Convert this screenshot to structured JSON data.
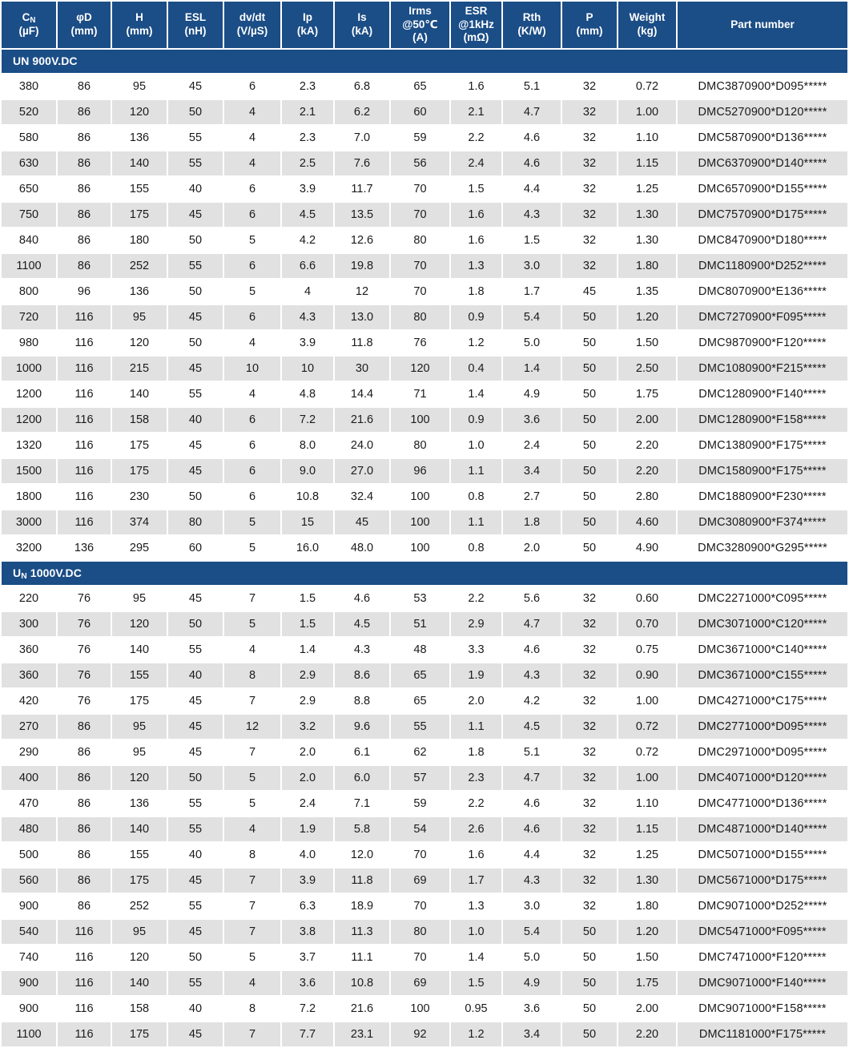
{
  "table": {
    "columns": [
      {
        "key": "cn",
        "name": "Cₙ",
        "sub": "N",
        "base": "C",
        "unit": "(µF)"
      },
      {
        "key": "phid",
        "name": "φD",
        "unit": "(mm)"
      },
      {
        "key": "h",
        "name": "H",
        "unit": "(mm)"
      },
      {
        "key": "esl",
        "name": "ESL",
        "unit": "(nH)"
      },
      {
        "key": "dvdt",
        "name": "dv/dt",
        "unit": "(V/µS)"
      },
      {
        "key": "ip",
        "name": "Ip",
        "unit": "(kA)"
      },
      {
        "key": "is",
        "name": "Is",
        "unit": "(kA)"
      },
      {
        "key": "irms",
        "name": "Irms",
        "unit2": "@50℃",
        "unit": "(A)"
      },
      {
        "key": "esr",
        "name": "ESR",
        "unit2": "@1kHz",
        "unit": "(mΩ)"
      },
      {
        "key": "rth",
        "name": "Rth",
        "unit": "(K/W)"
      },
      {
        "key": "p",
        "name": "P",
        "unit": "(mm)"
      },
      {
        "key": "weight",
        "name": "Weight",
        "unit": "(kg)"
      },
      {
        "key": "part",
        "name": "Part number",
        "unit": ""
      }
    ],
    "sections": [
      {
        "title_base": "UN",
        "title_sub": "",
        "title_rest": " 900V.DC",
        "title_full": "UN 900V.DC",
        "rows": [
          [
            "380",
            "86",
            "95",
            "45",
            "6",
            "2.3",
            "6.8",
            "65",
            "1.6",
            "5.1",
            "32",
            "0.72",
            "DMC3870900*D095*****"
          ],
          [
            "520",
            "86",
            "120",
            "50",
            "4",
            "2.1",
            "6.2",
            "60",
            "2.1",
            "4.7",
            "32",
            "1.00",
            "DMC5270900*D120*****"
          ],
          [
            "580",
            "86",
            "136",
            "55",
            "4",
            "2.3",
            "7.0",
            "59",
            "2.2",
            "4.6",
            "32",
            "1.10",
            "DMC5870900*D136*****"
          ],
          [
            "630",
            "86",
            "140",
            "55",
            "4",
            "2.5",
            "7.6",
            "56",
            "2.4",
            "4.6",
            "32",
            "1.15",
            "DMC6370900*D140*****"
          ],
          [
            "650",
            "86",
            "155",
            "40",
            "6",
            "3.9",
            "11.7",
            "70",
            "1.5",
            "4.4",
            "32",
            "1.25",
            "DMC6570900*D155*****"
          ],
          [
            "750",
            "86",
            "175",
            "45",
            "6",
            "4.5",
            "13.5",
            "70",
            "1.6",
            "4.3",
            "32",
            "1.30",
            "DMC7570900*D175*****"
          ],
          [
            "840",
            "86",
            "180",
            "50",
            "5",
            "4.2",
            "12.6",
            "80",
            "1.6",
            "1.5",
            "32",
            "1.30",
            "DMC8470900*D180*****"
          ],
          [
            "1100",
            "86",
            "252",
            "55",
            "6",
            "6.6",
            "19.8",
            "70",
            "1.3",
            "3.0",
            "32",
            "1.80",
            "DMC1180900*D252*****"
          ],
          [
            "800",
            "96",
            "136",
            "50",
            "5",
            "4",
            "12",
            "70",
            "1.8",
            "1.7",
            "45",
            "1.35",
            "DMC8070900*E136*****"
          ],
          [
            "720",
            "116",
            "95",
            "45",
            "6",
            "4.3",
            "13.0",
            "80",
            "0.9",
            "5.4",
            "50",
            "1.20",
            "DMC7270900*F095*****"
          ],
          [
            "980",
            "116",
            "120",
            "50",
            "4",
            "3.9",
            "11.8",
            "76",
            "1.2",
            "5.0",
            "50",
            "1.50",
            "DMC9870900*F120*****"
          ],
          [
            "1000",
            "116",
            "215",
            "45",
            "10",
            "10",
            "30",
            "120",
            "0.4",
            "1.4",
            "50",
            "2.50",
            "DMC1080900*F215*****"
          ],
          [
            "1200",
            "116",
            "140",
            "55",
            "4",
            "4.8",
            "14.4",
            "71",
            "1.4",
            "4.9",
            "50",
            "1.75",
            "DMC1280900*F140*****"
          ],
          [
            "1200",
            "116",
            "158",
            "40",
            "6",
            "7.2",
            "21.6",
            "100",
            "0.9",
            "3.6",
            "50",
            "2.00",
            "DMC1280900*F158*****"
          ],
          [
            "1320",
            "116",
            "175",
            "45",
            "6",
            "8.0",
            "24.0",
            "80",
            "1.0",
            "2.4",
            "50",
            "2.20",
            "DMC1380900*F175*****"
          ],
          [
            "1500",
            "116",
            "175",
            "45",
            "6",
            "9.0",
            "27.0",
            "96",
            "1.1",
            "3.4",
            "50",
            "2.20",
            "DMC1580900*F175*****"
          ],
          [
            "1800",
            "116",
            "230",
            "50",
            "6",
            "10.8",
            "32.4",
            "100",
            "0.8",
            "2.7",
            "50",
            "2.80",
            "DMC1880900*F230*****"
          ],
          [
            "3000",
            "116",
            "374",
            "80",
            "5",
            "15",
            "45",
            "100",
            "1.1",
            "1.8",
            "50",
            "4.60",
            "DMC3080900*F374*****"
          ],
          [
            "3200",
            "136",
            "295",
            "60",
            "5",
            "16.0",
            "48.0",
            "100",
            "0.8",
            "2.0",
            "50",
            "4.90",
            "DMC3280900*G295*****"
          ]
        ]
      },
      {
        "title_base": "U",
        "title_sub": "N",
        "title_rest": " 1000V.DC",
        "title_full": "UN 1000V.DC",
        "rows": [
          [
            "220",
            "76",
            "95",
            "45",
            "7",
            "1.5",
            "4.6",
            "53",
            "2.2",
            "5.6",
            "32",
            "0.60",
            "DMC2271000*C095*****"
          ],
          [
            "300",
            "76",
            "120",
            "50",
            "5",
            "1.5",
            "4.5",
            "51",
            "2.9",
            "4.7",
            "32",
            "0.70",
            "DMC3071000*C120*****"
          ],
          [
            "360",
            "76",
            "140",
            "55",
            "4",
            "1.4",
            "4.3",
            "48",
            "3.3",
            "4.6",
            "32",
            "0.75",
            "DMC3671000*C140*****"
          ],
          [
            "360",
            "76",
            "155",
            "40",
            "8",
            "2.9",
            "8.6",
            "65",
            "1.9",
            "4.3",
            "32",
            "0.90",
            "DMC3671000*C155*****"
          ],
          [
            "420",
            "76",
            "175",
            "45",
            "7",
            "2.9",
            "8.8",
            "65",
            "2.0",
            "4.2",
            "32",
            "1.00",
            "DMC4271000*C175*****"
          ],
          [
            "270",
            "86",
            "95",
            "45",
            "12",
            "3.2",
            "9.6",
            "55",
            "1.1",
            "4.5",
            "32",
            "0.72",
            "DMC2771000*D095*****"
          ],
          [
            "290",
            "86",
            "95",
            "45",
            "7",
            "2.0",
            "6.1",
            "62",
            "1.8",
            "5.1",
            "32",
            "0.72",
            "DMC2971000*D095*****"
          ],
          [
            "400",
            "86",
            "120",
            "50",
            "5",
            "2.0",
            "6.0",
            "57",
            "2.3",
            "4.7",
            "32",
            "1.00",
            "DMC4071000*D120*****"
          ],
          [
            "470",
            "86",
            "136",
            "55",
            "5",
            "2.4",
            "7.1",
            "59",
            "2.2",
            "4.6",
            "32",
            "1.10",
            "DMC4771000*D136*****"
          ],
          [
            "480",
            "86",
            "140",
            "55",
            "4",
            "1.9",
            "5.8",
            "54",
            "2.6",
            "4.6",
            "32",
            "1.15",
            "DMC4871000*D140*****"
          ],
          [
            "500",
            "86",
            "155",
            "40",
            "8",
            "4.0",
            "12.0",
            "70",
            "1.6",
            "4.4",
            "32",
            "1.25",
            "DMC5071000*D155*****"
          ],
          [
            "560",
            "86",
            "175",
            "45",
            "7",
            "3.9",
            "11.8",
            "69",
            "1.7",
            "4.3",
            "32",
            "1.30",
            "DMC5671000*D175*****"
          ],
          [
            "900",
            "86",
            "252",
            "55",
            "7",
            "6.3",
            "18.9",
            "70",
            "1.3",
            "3.0",
            "32",
            "1.80",
            "DMC9071000*D252*****"
          ],
          [
            "540",
            "116",
            "95",
            "45",
            "7",
            "3.8",
            "11.3",
            "80",
            "1.0",
            "5.4",
            "50",
            "1.20",
            "DMC5471000*F095*****"
          ],
          [
            "740",
            "116",
            "120",
            "50",
            "5",
            "3.7",
            "11.1",
            "70",
            "1.4",
            "5.0",
            "50",
            "1.50",
            "DMC7471000*F120*****"
          ],
          [
            "900",
            "116",
            "140",
            "55",
            "4",
            "3.6",
            "10.8",
            "69",
            "1.5",
            "4.9",
            "50",
            "1.75",
            "DMC9071000*F140*****"
          ],
          [
            "900",
            "116",
            "158",
            "40",
            "8",
            "7.2",
            "21.6",
            "100",
            "0.95",
            "3.6",
            "50",
            "2.00",
            "DMC9071000*F158*****"
          ],
          [
            "1100",
            "116",
            "175",
            "45",
            "7",
            "7.7",
            "23.1",
            "92",
            "1.2",
            "3.4",
            "50",
            "2.20",
            "DMC1181000*F175*****"
          ]
        ]
      }
    ]
  },
  "colors": {
    "header_blue": "#1b4d86",
    "row_shaded": "#e1e1e1",
    "row_plain": "#ffffff",
    "text": "#1a1a1a"
  }
}
